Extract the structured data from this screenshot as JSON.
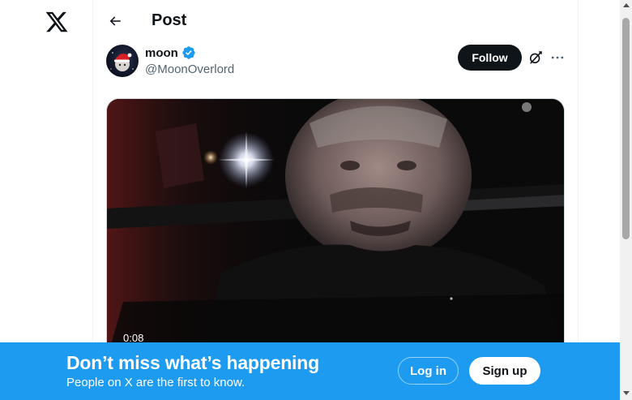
{
  "app": {
    "logo_icon": "x-logo-icon"
  },
  "header": {
    "title": "Post",
    "back_icon": "arrow-left-icon"
  },
  "post": {
    "author_name": "moon",
    "author_handle": "@MoonOverlord",
    "verified_icon": "verified-badge-icon",
    "follow_label": "Follow",
    "grok_icon": "grok-icon",
    "more_icon": "more-dots-icon",
    "video": {
      "timestamp": "0:08"
    }
  },
  "banner": {
    "title": "Don’t miss what’s happening",
    "subtitle": "People on X are the first to know.",
    "login_label": "Log in",
    "signup_label": "Sign up"
  },
  "colors": {
    "accent": "#1d9bf0",
    "text": "#0f1419",
    "muted": "#536471"
  }
}
